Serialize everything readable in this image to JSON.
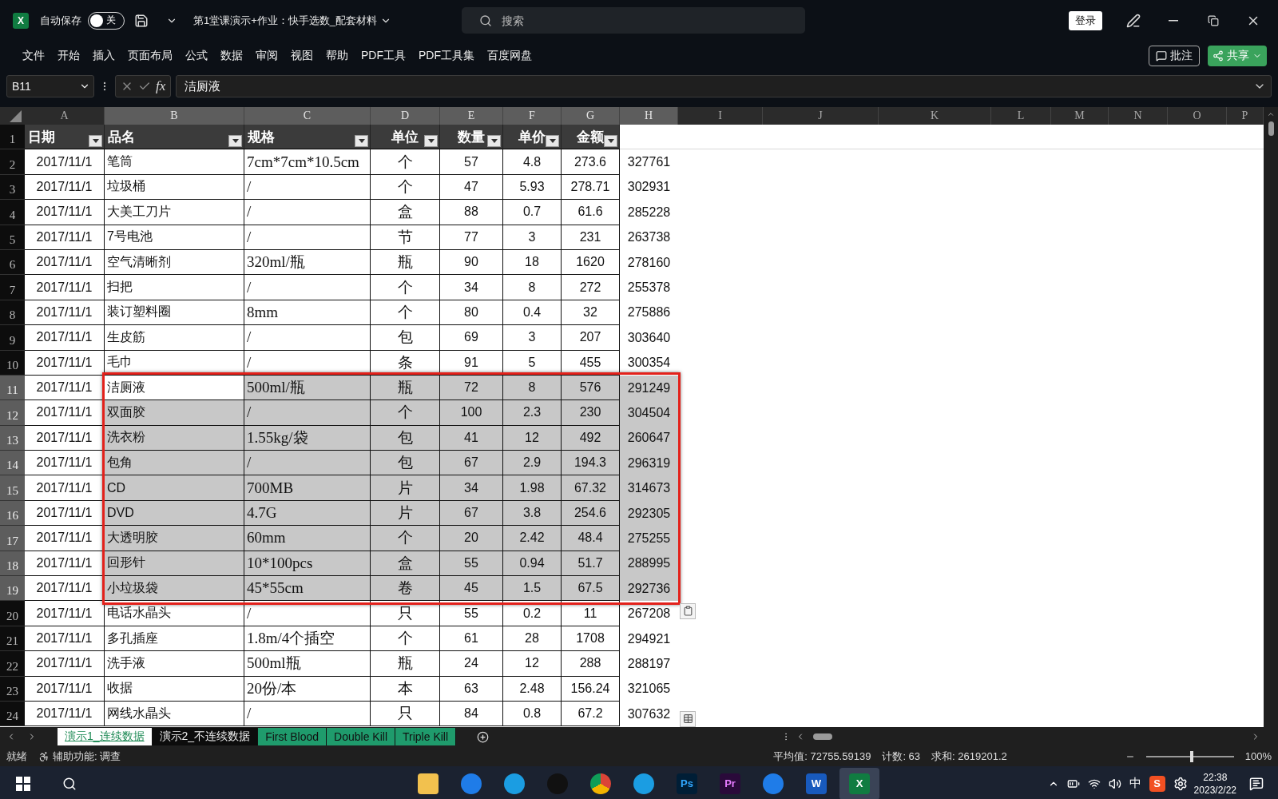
{
  "title_bar": {
    "logo": "X",
    "autosave_label": "自动保存",
    "autosave_toggle": {
      "on": false,
      "label": "关"
    },
    "document_title": "第1堂课演示+作业：快手选数_配套材料",
    "search": {
      "placeholder": "搜索"
    },
    "login_button": "登录"
  },
  "ribbon": {
    "tabs": [
      "文件",
      "开始",
      "插入",
      "页面布局",
      "公式",
      "数据",
      "审阅",
      "视图",
      "帮助",
      "PDF工具",
      "PDF工具集",
      "百度网盘"
    ],
    "comment_button": "批注",
    "share_button": "共享"
  },
  "formula_bar": {
    "name_box": "B11",
    "function_label": "fx",
    "formula": "洁厕液"
  },
  "sheet": {
    "columns": [
      {
        "letter": "A",
        "selected": false
      },
      {
        "letter": "B",
        "selected": true
      },
      {
        "letter": "C",
        "selected": true
      },
      {
        "letter": "D",
        "selected": true
      },
      {
        "letter": "E",
        "selected": true
      },
      {
        "letter": "F",
        "selected": true
      },
      {
        "letter": "G",
        "selected": true
      },
      {
        "letter": "H",
        "selected": true
      },
      {
        "letter": "I",
        "selected": false
      },
      {
        "letter": "J",
        "selected": false
      },
      {
        "letter": "K",
        "selected": false
      },
      {
        "letter": "L",
        "selected": false
      },
      {
        "letter": "M",
        "selected": false
      },
      {
        "letter": "N",
        "selected": false
      },
      {
        "letter": "O",
        "selected": false
      },
      {
        "letter": "P",
        "selected": false
      }
    ],
    "header_row": {
      "number": "1",
      "cells": [
        "日期",
        "品名",
        "规格",
        "单位",
        "数量",
        "单价",
        "金额"
      ]
    },
    "rows": [
      {
        "number": "2",
        "cells": [
          "2017/11/1",
          "笔筒",
          "7cm*7cm*10.5cm",
          "个",
          "57",
          "4.8",
          "273.6",
          "327761"
        ],
        "selected": false,
        "active": false
      },
      {
        "number": "3",
        "cells": [
          "2017/11/1",
          "垃圾桶",
          "/",
          "个",
          "47",
          "5.93",
          "278.71",
          "302931"
        ],
        "selected": false,
        "active": false
      },
      {
        "number": "4",
        "cells": [
          "2017/11/1",
          "大美工刀片",
          "/",
          "盒",
          "88",
          "0.7",
          "61.6",
          "285228"
        ],
        "selected": false,
        "active": false
      },
      {
        "number": "5",
        "cells": [
          "2017/11/1",
          "7号电池",
          "/",
          "节",
          "77",
          "3",
          "231",
          "263738"
        ],
        "selected": false,
        "active": false
      },
      {
        "number": "6",
        "cells": [
          "2017/11/1",
          "空气清晰剂",
          "320ml/瓶",
          "瓶",
          "90",
          "18",
          "1620",
          "278160"
        ],
        "selected": false,
        "active": false
      },
      {
        "number": "7",
        "cells": [
          "2017/11/1",
          "扫把",
          "/",
          "个",
          "34",
          "8",
          "272",
          "255378"
        ],
        "selected": false,
        "active": false
      },
      {
        "number": "8",
        "cells": [
          "2017/11/1",
          "装订塑料圈",
          "8mm",
          "个",
          "80",
          "0.4",
          "32",
          "275886"
        ],
        "selected": false,
        "active": false
      },
      {
        "number": "9",
        "cells": [
          "2017/11/1",
          "生皮筋",
          "/",
          "包",
          "69",
          "3",
          "207",
          "303640"
        ],
        "selected": false,
        "active": false
      },
      {
        "number": "10",
        "cells": [
          "2017/11/1",
          "毛巾",
          "/",
          "条",
          "91",
          "5",
          "455",
          "300354"
        ],
        "selected": false,
        "active": false
      },
      {
        "number": "11",
        "cells": [
          "2017/11/1",
          "洁厕液",
          "500ml/瓶",
          "瓶",
          "72",
          "8",
          "576",
          "291249"
        ],
        "selected": true,
        "active": true
      },
      {
        "number": "12",
        "cells": [
          "2017/11/1",
          "双面胶",
          "/",
          "个",
          "100",
          "2.3",
          "230",
          "304504"
        ],
        "selected": true,
        "active": false
      },
      {
        "number": "13",
        "cells": [
          "2017/11/1",
          "洗衣粉",
          "1.55kg/袋",
          "包",
          "41",
          "12",
          "492",
          "260647"
        ],
        "selected": true,
        "active": false
      },
      {
        "number": "14",
        "cells": [
          "2017/11/1",
          "包角",
          "/",
          "包",
          "67",
          "2.9",
          "194.3",
          "296319"
        ],
        "selected": true,
        "active": false
      },
      {
        "number": "15",
        "cells": [
          "2017/11/1",
          "CD",
          "700MB",
          "片",
          "34",
          "1.98",
          "67.32",
          "314673"
        ],
        "selected": true,
        "active": false
      },
      {
        "number": "16",
        "cells": [
          "2017/11/1",
          "DVD",
          "4.7G",
          "片",
          "67",
          "3.8",
          "254.6",
          "292305"
        ],
        "selected": true,
        "active": false
      },
      {
        "number": "17",
        "cells": [
          "2017/11/1",
          "大透明胶",
          "60mm",
          "个",
          "20",
          "2.42",
          "48.4",
          "275255"
        ],
        "selected": true,
        "active": false
      },
      {
        "number": "18",
        "cells": [
          "2017/11/1",
          "回形针",
          "10*100pcs",
          "盒",
          "55",
          "0.94",
          "51.7",
          "288995"
        ],
        "selected": true,
        "active": false
      },
      {
        "number": "19",
        "cells": [
          "2017/11/1",
          "小垃圾袋",
          "45*55cm",
          "卷",
          "45",
          "1.5",
          "67.5",
          "292736"
        ],
        "selected": true,
        "active": false
      },
      {
        "number": "20",
        "cells": [
          "2017/11/1",
          "电话水晶头",
          "/",
          "只",
          "55",
          "0.2",
          "11",
          "267208"
        ],
        "selected": false,
        "active": false
      },
      {
        "number": "21",
        "cells": [
          "2017/11/1",
          "多孔插座",
          "1.8m/4个插空",
          "个",
          "61",
          "28",
          "1708",
          "294921"
        ],
        "selected": false,
        "active": false
      },
      {
        "number": "22",
        "cells": [
          "2017/11/1",
          "洗手液",
          "500ml瓶",
          "瓶",
          "24",
          "12",
          "288",
          "288197"
        ],
        "selected": false,
        "active": false
      },
      {
        "number": "23",
        "cells": [
          "2017/11/1",
          "收据",
          "20份/本",
          "本",
          "63",
          "2.48",
          "156.24",
          "321065"
        ],
        "selected": false,
        "active": false
      },
      {
        "number": "24",
        "cells": [
          "2017/11/1",
          "网线水晶头",
          "/",
          "只",
          "84",
          "0.8",
          "67.2",
          "307632"
        ],
        "selected": false,
        "active": false
      }
    ]
  },
  "sheet_tabs": [
    {
      "label": "演示1_连续数据",
      "selected": true
    },
    {
      "label": "演示2_不连续数据",
      "selected": false
    },
    {
      "label": "First Blood",
      "selected": false,
      "color": "#1f9b6c"
    },
    {
      "label": "Double Kill",
      "selected": false,
      "color": "#1f9b6c"
    },
    {
      "label": "Triple Kill",
      "selected": false,
      "color": "#1f9b6c"
    }
  ],
  "status_bar": {
    "ready": "就绪",
    "accessibility": "辅助功能: 调查",
    "average": "平均值: 72755.59139",
    "count": "计数: 63",
    "sum": "求和: 2619201.2",
    "zoom_slider": {
      "level": 0.5
    },
    "zoom": "100%"
  },
  "taskbar": {
    "apps": [
      {
        "kind": "folder",
        "selected": false
      },
      {
        "kind": "qbrowser",
        "selected": false
      },
      {
        "kind": "edge",
        "selected": false
      },
      {
        "kind": "qq",
        "selected": false
      },
      {
        "kind": "chrome",
        "selected": false
      },
      {
        "kind": "edge",
        "selected": false
      },
      {
        "kind": "ps",
        "label": "Ps",
        "selected": false
      },
      {
        "kind": "pr",
        "label": "Pr",
        "selected": false
      },
      {
        "kind": "qbrowser",
        "selected": false
      },
      {
        "kind": "word",
        "label": "W",
        "selected": false
      },
      {
        "kind": "excel",
        "label": "X",
        "selected": true
      }
    ],
    "ime": "中",
    "sogou": "S",
    "time": "22:38",
    "date": "2023/2/22"
  }
}
